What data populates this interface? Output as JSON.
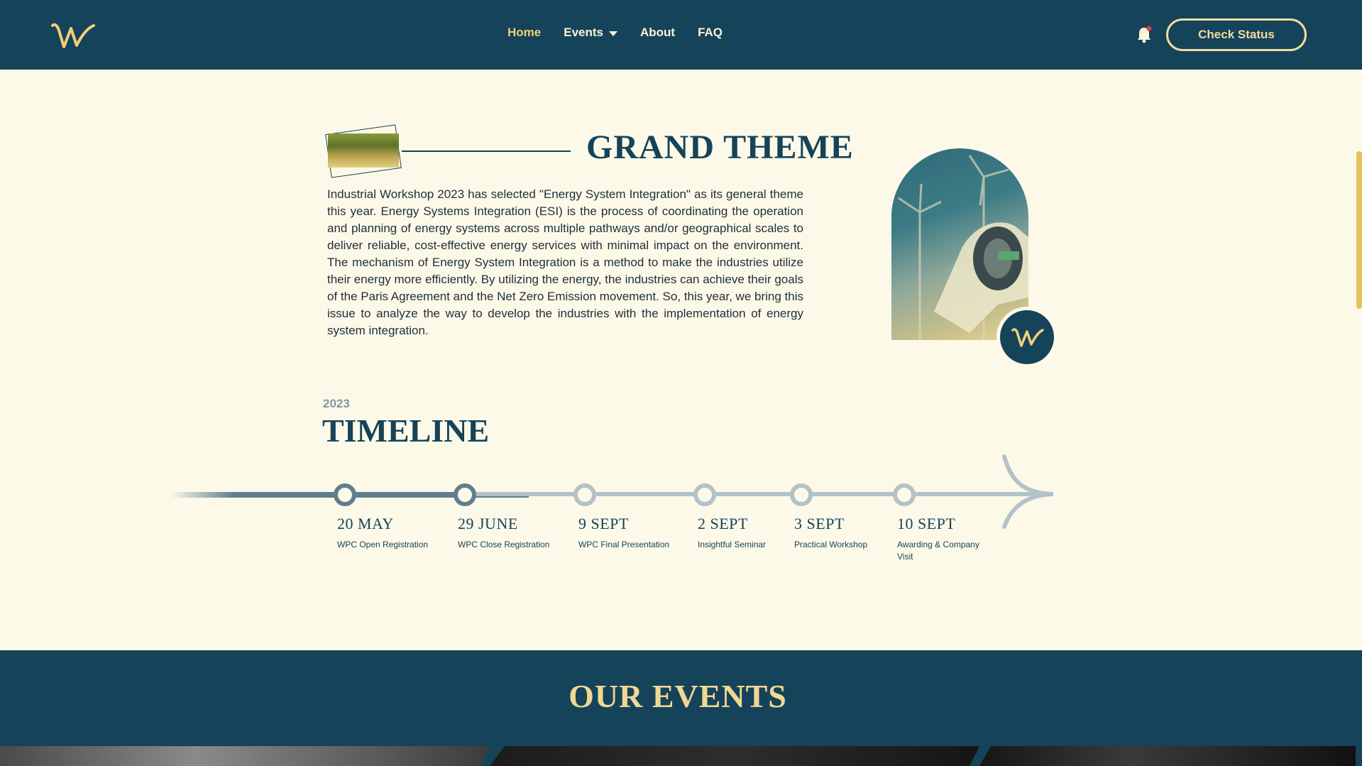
{
  "nav": {
    "links": [
      {
        "label": "Home",
        "active": true
      },
      {
        "label": "Events",
        "has_dropdown": true
      },
      {
        "label": "About"
      },
      {
        "label": "FAQ"
      }
    ],
    "notification_icon": "bell-icon",
    "check_status_label": "Check Status"
  },
  "grand_theme": {
    "title": "GRAND THEME",
    "body": "Industrial Workshop 2023 has selected \"Energy System Integration\" as its general theme this year. Energy Systems Integration (ESI) is the process of coordinating the operation and planning of energy systems across multiple pathways and/or geographical scales to deliver reliable, cost-effective energy services with minimal impact on the environment. The mechanism of Energy System Integration is a method to make the industries utilize their energy more efficiently. By utilizing the energy, the industries can achieve their goals of the Paris Agreement and the Net Zero Emission movement. So, this year, we bring this issue to analyze the way to develop the industries with the implementation of energy system integration."
  },
  "timeline": {
    "year": "2023",
    "title": "TIMELINE",
    "milestones": [
      {
        "date": "20 MAY",
        "label": "WPC Open Registration",
        "done": true
      },
      {
        "date": "29 JUNE",
        "label": "WPC Close Registration",
        "done": true
      },
      {
        "date": "9 SEPT",
        "label": "WPC Final Presentation",
        "done": false
      },
      {
        "date": "2 SEPT",
        "label": "Insightful Seminar",
        "done": false
      },
      {
        "date": "3 SEPT",
        "label": "Practical Workshop",
        "done": false
      },
      {
        "date": "10 SEPT",
        "label": "Awarding & Company Visit",
        "done": false
      }
    ]
  },
  "events": {
    "title": "OUR EVENTS"
  },
  "colors": {
    "navy": "#15435a",
    "cream": "#fdf9e8",
    "gold": "#f0cf77",
    "muted": "#b2c2c8"
  }
}
